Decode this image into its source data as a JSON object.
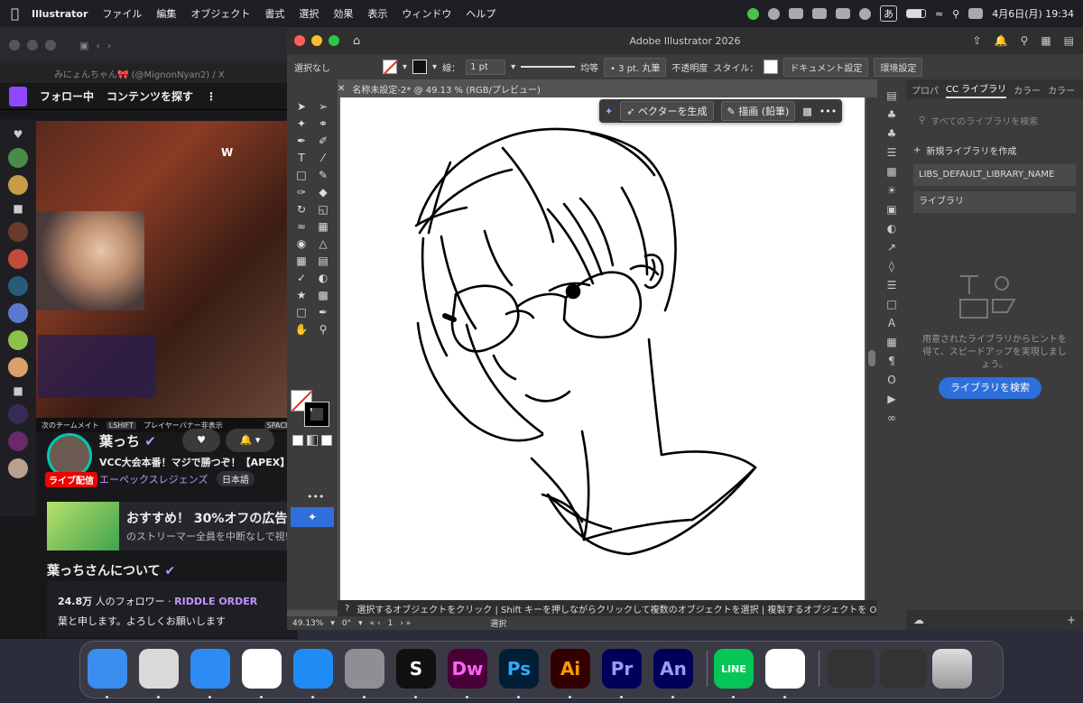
{
  "menubar": {
    "app": "Illustrator",
    "items": [
      "ファイル",
      "編集",
      "オブジェクト",
      "書式",
      "選択",
      "効果",
      "表示",
      "ウィンドウ",
      "ヘルプ"
    ],
    "input_mode": "あ",
    "clock": "4月6日(月)  19:34"
  },
  "browser": {
    "tab_title": "みにょんちゃん🎀 (@MignonNyan2) / X",
    "twitch": {
      "nav": [
        "フォロー中",
        "コンテンツを探す"
      ],
      "video": {
        "w_marker": "W",
        "bar_left": "次のチームメイト",
        "bar_key": "LSHIFT",
        "bar_mid": "プレイヤーバナー非表示",
        "bar_right": "SPACE"
      },
      "channel": {
        "name": "葉っち",
        "title": "VCC大会本番！マジで勝つぞ！【APEX】",
        "live": "ライブ配信",
        "game": "エーペックスレジェンズ",
        "language": "日本語"
      },
      "promo": {
        "line1": "おすすめ！ 30%オフの広告",
        "line2": "のストリーマー全員を中断なしで視!"
      },
      "about": {
        "heading": "葉っちさんについて",
        "followers_count": "24.8万",
        "followers_text": "人のフォロワー · ",
        "team": "RIDDLE ORDER",
        "bio": "葉と申します。よろしくお願いします"
      }
    }
  },
  "illustrator": {
    "window_title": "Adobe Illustrator 2026",
    "control": {
      "selection": "選択なし",
      "stroke_label": "線：",
      "stroke_value": "1 pt",
      "profile": "均等",
      "brush": "3 pt. 丸筆",
      "opacity_label": "不透明度",
      "style_label": "スタイル：",
      "doc_setup": "ドキュメント設定",
      "prefs": "環境設定"
    },
    "doc_tab": "名称未設定-2* @ 49.13 % (RGB/プレビュー)",
    "context_bar": {
      "generate": "ベクターを生成",
      "draw": "描画 (鉛筆)"
    },
    "status_hint": "選択するオブジェクトをクリック  |  Shift キーを押しながらクリックして複数のオブジェクトを選択  |  複製するオブジェクトを Option キー",
    "bottom": {
      "zoom": "49.13%",
      "rotation": "0°",
      "artboard": "1",
      "mode": "選択"
    },
    "panel": {
      "tabs": [
        "プロパ",
        "CC ライブラリ",
        "カラー",
        "カラー"
      ],
      "active_tab": "CC ライブラリ",
      "search_placeholder": "すべてのライブラリを検索",
      "new_library": "新規ライブラリを作成",
      "libraries": [
        "LIBS_DEFAULT_LIBRARY_NAME",
        "ライブラリ"
      ],
      "hint": "用意されたライブラリからヒントを得て、スピードアップを実現しましょう。",
      "cta": "ライブラリを検索"
    }
  },
  "dock": {
    "apps": [
      {
        "label": "",
        "name": "finder",
        "color": "#3b8ef0"
      },
      {
        "label": "",
        "name": "launchpad",
        "color": "#d9d9d9"
      },
      {
        "label": "",
        "name": "safari",
        "color": "#2c8cf4"
      },
      {
        "label": "",
        "name": "chrome",
        "color": "#ffffff"
      },
      {
        "label": "",
        "name": "app-store",
        "color": "#1f8cf6"
      },
      {
        "label": "",
        "name": "system-settings",
        "color": "#8e8e93"
      },
      {
        "label": "S",
        "name": "s-app",
        "color": "#111111"
      },
      {
        "label": "Dw",
        "name": "dreamweaver",
        "color": "#470137"
      },
      {
        "label": "Ps",
        "name": "photoshop",
        "color": "#001e36"
      },
      {
        "label": "Ai",
        "name": "illustrator",
        "color": "#330000"
      },
      {
        "label": "Pr",
        "name": "premiere",
        "color": "#00005b"
      },
      {
        "label": "An",
        "name": "animate",
        "color": "#00005b"
      },
      {
        "label": "LINE",
        "name": "line",
        "color": "#06c755"
      },
      {
        "label": "",
        "name": "vscode",
        "color": "#ffffff"
      }
    ]
  }
}
